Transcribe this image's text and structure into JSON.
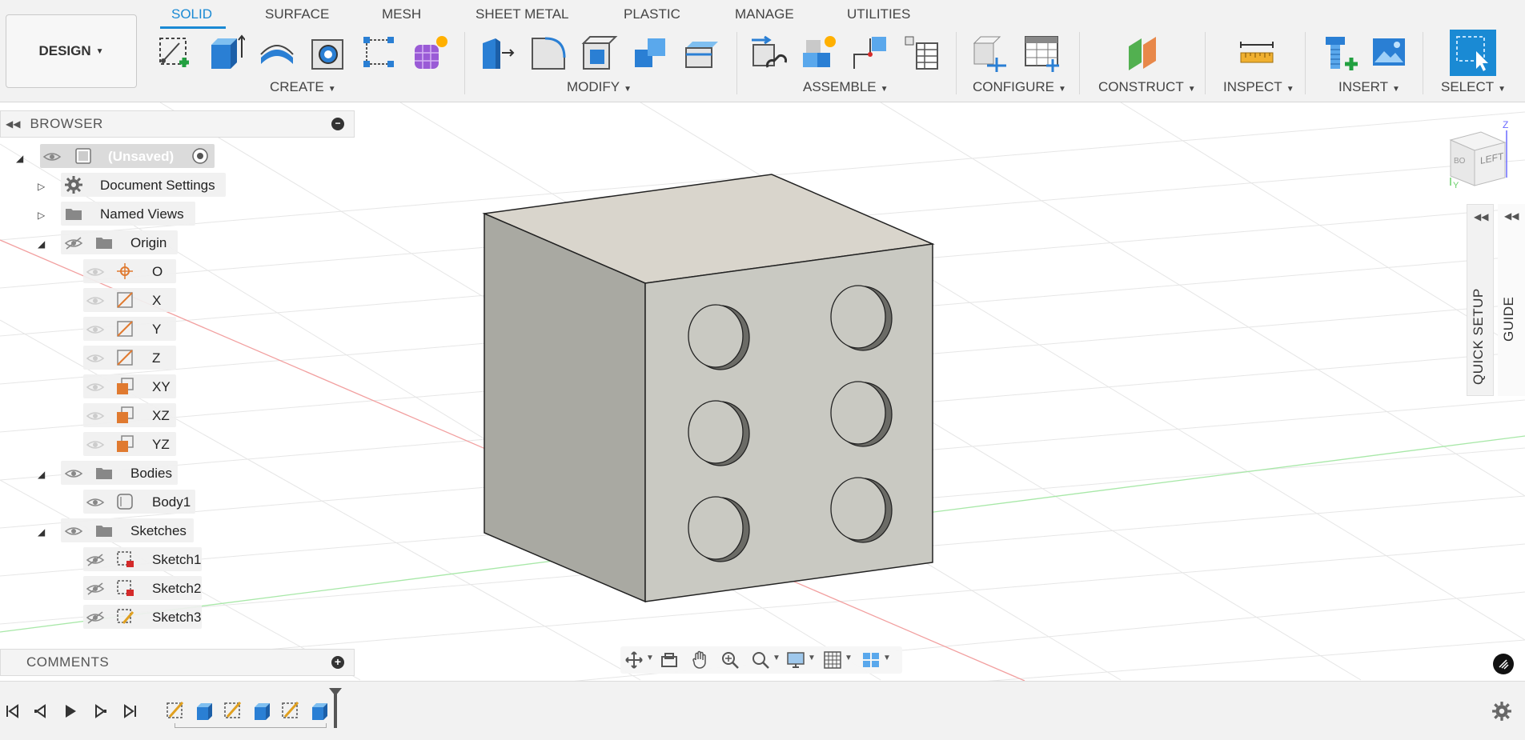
{
  "workspace": {
    "label": "DESIGN"
  },
  "tabs": [
    {
      "label": "SOLID",
      "active": true
    },
    {
      "label": "SURFACE"
    },
    {
      "label": "MESH"
    },
    {
      "label": "SHEET METAL"
    },
    {
      "label": "PLASTIC"
    },
    {
      "label": "MANAGE"
    },
    {
      "label": "UTILITIES"
    }
  ],
  "groups": {
    "create": "CREATE",
    "modify": "MODIFY",
    "assemble": "ASSEMBLE",
    "configure": "CONFIGURE",
    "construct": "CONSTRUCT",
    "inspect": "INSPECT",
    "insert": "INSERT",
    "select": "SELECT"
  },
  "browser": {
    "title": "BROWSER",
    "root": "(Unsaved)",
    "items": {
      "document_settings": "Document Settings",
      "named_views": "Named Views",
      "origin": "Origin",
      "origin_o": "O",
      "origin_x": "X",
      "origin_y": "Y",
      "origin_z": "Z",
      "origin_xy": "XY",
      "origin_xz": "XZ",
      "origin_yz": "YZ",
      "bodies": "Bodies",
      "body1": "Body1",
      "sketches": "Sketches",
      "sketch1": "Sketch1",
      "sketch2": "Sketch2",
      "sketch3": "Sketch3"
    }
  },
  "comments": {
    "title": "COMMENTS"
  },
  "panels": {
    "quick_setup": "QUICK SETUP",
    "guide": "GUIDE"
  },
  "viewcube": {
    "face": "LEFT",
    "side": "BO",
    "axis_z": "Z",
    "axis_y": "Y"
  },
  "colors": {
    "accent": "#1a8ad4",
    "cube_front": "#c8c8c0",
    "cube_side": "#a8a8a0",
    "cube_top": "#d8d4cc",
    "axis_red": "#f08080",
    "axis_green": "#90e090"
  }
}
